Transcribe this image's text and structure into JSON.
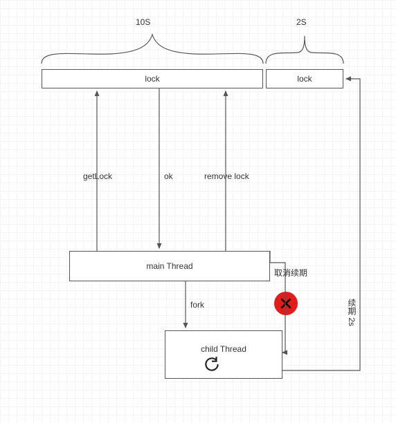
{
  "timeLabels": {
    "left": "10S",
    "right": "2S"
  },
  "locks": {
    "main": "lock",
    "right": "lock"
  },
  "arrows": {
    "getLock": "getLock",
    "ok": "ok",
    "removeLock": "remove lock",
    "fork": "fork"
  },
  "threads": {
    "main": "main Thread",
    "child": "child Thread"
  },
  "annotations": {
    "cancelRenewal": "取消续期",
    "renew2s": "续期 2s"
  },
  "chart_data": {
    "type": "flow-diagram",
    "title": "",
    "nodes": [
      {
        "id": "lock1",
        "label": "lock",
        "kind": "rect"
      },
      {
        "id": "lock2",
        "label": "lock",
        "kind": "rect"
      },
      {
        "id": "mainThread",
        "label": "main Thread",
        "kind": "rect"
      },
      {
        "id": "childThread",
        "label": "child Thread",
        "kind": "rect"
      }
    ],
    "edges": [
      {
        "from": "mainThread",
        "to": "lock1",
        "label": "getLock",
        "direction": "up"
      },
      {
        "from": "lock1",
        "to": "mainThread",
        "label": "ok",
        "direction": "down"
      },
      {
        "from": "mainThread",
        "to": "lock1",
        "label": "remove lock",
        "direction": "up"
      },
      {
        "from": "mainThread",
        "to": "childThread",
        "label": "fork",
        "direction": "down"
      },
      {
        "from": "mainThread",
        "to": "childThread",
        "label": "取消续期",
        "blocked": true
      },
      {
        "from": "childThread",
        "to": "lock2",
        "label": "续期 2s",
        "direction": "up"
      }
    ],
    "time_brackets": [
      {
        "label": "10S",
        "span": "lock1"
      },
      {
        "label": "2S",
        "span": "lock2"
      }
    ]
  }
}
